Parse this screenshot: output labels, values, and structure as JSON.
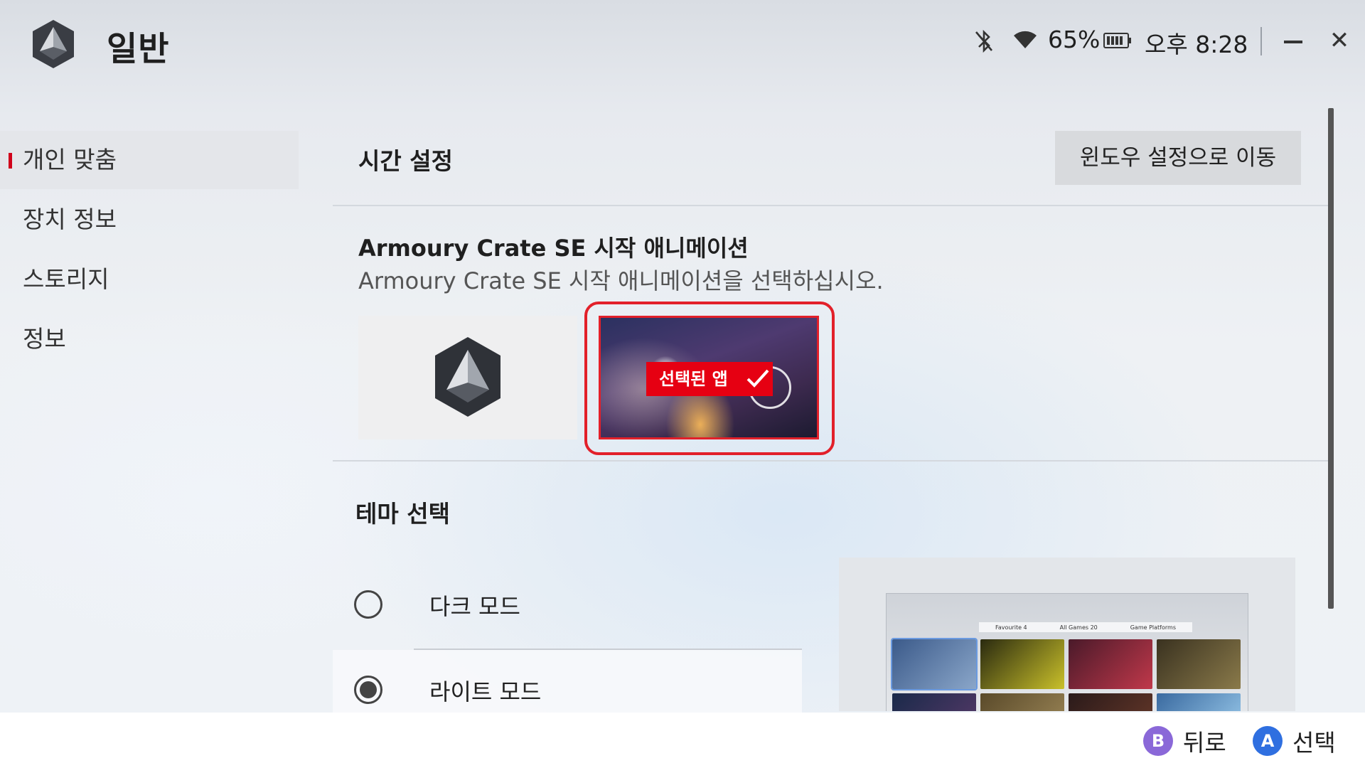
{
  "header": {
    "title": "일반",
    "battery_percent": "65%",
    "clock": "오후 8:28",
    "icons": [
      "app-logo",
      "bluetooth-off-icon",
      "wifi-icon",
      "battery-icon",
      "minimize-icon",
      "close-icon"
    ]
  },
  "sidebar": {
    "items": [
      {
        "label": "개인 맞춤",
        "active": true
      },
      {
        "label": "장치 정보",
        "active": false
      },
      {
        "label": "스토리지",
        "active": false
      },
      {
        "label": "정보",
        "active": false
      }
    ]
  },
  "time_settings": {
    "title": "시간 설정",
    "button_label": "윈도우 설정으로 이동"
  },
  "startup_animation": {
    "title": "Armoury Crate SE 시작 애니메이션",
    "description": "Armoury Crate SE 시작 애니메이션을 선택하십시오.",
    "selected_badge": "선택된 앱",
    "options": [
      "default-logo",
      "app-artwork"
    ],
    "selected_index": 1
  },
  "theme": {
    "title": "테마 선택",
    "options": [
      {
        "label": "다크 모드",
        "selected": false
      },
      {
        "label": "라이트 모드",
        "selected": true
      }
    ],
    "preview_tabs": [
      "Favourite 4",
      "All Games 20",
      "Game Platforms"
    ]
  },
  "footer": {
    "back": {
      "key": "B",
      "label": "뒤로"
    },
    "select": {
      "key": "A",
      "label": "선택"
    }
  },
  "colors": {
    "accent_red": "#e2202a",
    "button_b": "#8a68d8",
    "button_a": "#2f6fe0"
  }
}
